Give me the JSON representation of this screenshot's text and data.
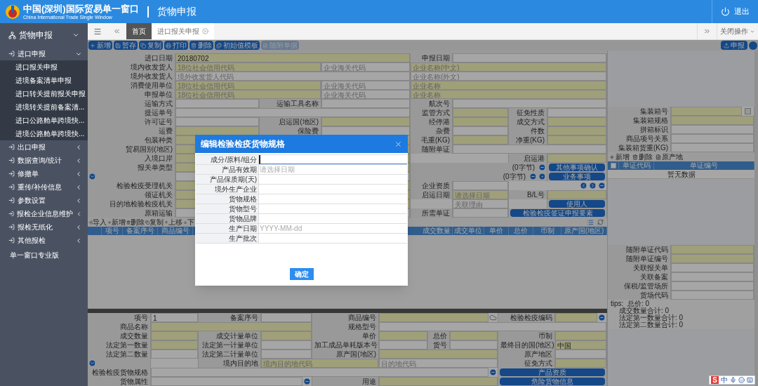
{
  "header": {
    "title": "中国(深圳)国际贸易单一窗口",
    "subtitle": "China International Trade Single Window",
    "section": "货物申报",
    "exit": "退出"
  },
  "sidebar": {
    "items": [
      {
        "label": "货物申报",
        "expanded": true,
        "children": [
          {
            "label": "进口申报",
            "expanded": true,
            "children": [
              {
                "label": "进口报关申报"
              },
              {
                "label": "进境备案清单申报"
              },
              {
                "label": "进口转关提前报关申报"
              },
              {
                "label": "进境转关提前备案清..."
              },
              {
                "label": "进口公路舱单跨境快..."
              },
              {
                "label": "进境公路舱单跨境快..."
              }
            ]
          },
          {
            "label": "出口申报",
            "expanded": false
          },
          {
            "label": "数据查询/统计",
            "expanded": false
          },
          {
            "label": "修撤单",
            "expanded": false
          },
          {
            "label": "重传/补传信息",
            "expanded": false
          },
          {
            "label": "参数设置",
            "expanded": false
          },
          {
            "label": "报检企业信息维护",
            "expanded": false
          },
          {
            "label": "报检无纸化",
            "expanded": false
          },
          {
            "label": "其他报检",
            "expanded": false
          }
        ]
      },
      {
        "label": "单一窗口专业版"
      }
    ]
  },
  "tabs": [
    {
      "label": "首页",
      "selected": false,
      "closable": false
    },
    {
      "label": "进口报关申报",
      "selected": true,
      "closable": true
    }
  ],
  "tab_menu": "关闭操作",
  "toolbar": {
    "buttons": [
      {
        "label": "新增",
        "disabled": false
      },
      {
        "label": "暂存",
        "disabled": false
      },
      {
        "label": "复制",
        "disabled": false
      },
      {
        "label": "打印",
        "disabled": false
      },
      {
        "label": "删除",
        "disabled": false
      },
      {
        "label": "初始值模板",
        "disabled": false
      },
      {
        "label": "随附单据",
        "disabled": true
      }
    ],
    "submit": "申报"
  },
  "main_form": {
    "lines": [
      {
        "items": [
          {
            "kind": "label",
            "text": "进口日期"
          },
          {
            "kind": "field",
            "value": "20180702",
            "required": true
          },
          {
            "kind": "label",
            "text": "申报日期"
          },
          {
            "kind": "field",
            "required": false
          }
        ]
      },
      {
        "items": [
          {
            "kind": "label",
            "text": "境内收发货人"
          },
          {
            "kind": "field",
            "placeholder": "18位社会信用代码",
            "required": true
          },
          {
            "kind": "field",
            "placeholder": "企业海关代码",
            "required": false
          },
          {
            "kind": "field",
            "placeholder": "企业名称(中文)",
            "required": true
          }
        ]
      },
      {
        "items": [
          {
            "kind": "label",
            "text": "境外收发货人"
          },
          {
            "kind": "field",
            "placeholder": "境外收发货人代码",
            "required": false
          },
          {
            "kind": "field",
            "placeholder": "企业名称(外文)",
            "required": false
          }
        ]
      },
      {
        "items": [
          {
            "kind": "label",
            "text": "消费使用单位"
          },
          {
            "kind": "field",
            "placeholder": "18位社会信用代码",
            "required": true
          },
          {
            "kind": "field",
            "placeholder": "企业海关代码",
            "required": false
          },
          {
            "kind": "field",
            "placeholder": "企业名称",
            "required": true
          }
        ]
      },
      {
        "items": [
          {
            "kind": "label",
            "text": "申报单位"
          },
          {
            "kind": "field",
            "placeholder": "18位社会信用代码",
            "required": true
          },
          {
            "kind": "field",
            "placeholder": "企业海关代码",
            "required": false
          },
          {
            "kind": "field",
            "placeholder": "企业名称",
            "required": true
          }
        ]
      },
      {
        "items": [
          {
            "kind": "label",
            "text": "运输方式"
          },
          {
            "kind": "field",
            "required": false
          },
          {
            "kind": "label",
            "text": "运输工具名称"
          },
          {
            "kind": "field",
            "required": false
          },
          {
            "kind": "label",
            "text": "航次号"
          },
          {
            "kind": "field",
            "required": false
          }
        ]
      },
      {
        "items": [
          {
            "kind": "label",
            "text": "提运单号"
          },
          {
            "kind": "field",
            "required": false
          },
          {
            "kind": "label",
            "text": "监管方式"
          },
          {
            "kind": "field",
            "required": true
          },
          {
            "kind": "label",
            "text": "征免性质"
          },
          {
            "kind": "field",
            "required": false
          }
        ]
      },
      {
        "items": [
          {
            "kind": "label",
            "text": "许可证号"
          },
          {
            "kind": "field",
            "required": false
          },
          {
            "kind": "label",
            "text": "启运国(地区)"
          },
          {
            "kind": "field",
            "required": true
          },
          {
            "kind": "label",
            "text": "经停港"
          },
          {
            "kind": "field",
            "required": true
          },
          {
            "kind": "label",
            "text": "成交方式"
          },
          {
            "kind": "field",
            "required": true
          }
        ]
      },
      {
        "items": [
          {
            "kind": "label",
            "text": "运费"
          },
          {
            "kind": "field",
            "required": true
          },
          {
            "kind": "label",
            "text": "保险费"
          },
          {
            "kind": "field",
            "required": false
          },
          {
            "kind": "label",
            "text": "杂费"
          },
          {
            "kind": "field",
            "required": false
          },
          {
            "kind": "label",
            "text": "件数"
          },
          {
            "kind": "field",
            "required": true
          }
        ]
      },
      {
        "items": [
          {
            "kind": "label",
            "text": "包装种类"
          },
          {
            "kind": "field",
            "required": true
          },
          {
            "kind": "label",
            "text": "毛重(KG)"
          },
          {
            "kind": "field",
            "required": true
          },
          {
            "kind": "label",
            "text": "净重(KG)"
          },
          {
            "kind": "field",
            "required": true
          }
        ]
      },
      {
        "items": [
          {
            "kind": "label",
            "text": "贸易国别(地区)"
          },
          {
            "kind": "field",
            "required": true
          },
          {
            "kind": "label",
            "text": "随附单证"
          },
          {
            "kind": "field",
            "required": false
          }
        ]
      },
      {
        "items": [
          {
            "kind": "label",
            "text": "入境口岸"
          },
          {
            "kind": "field",
            "required": true
          },
          {
            "kind": "blank"
          },
          {
            "kind": "label",
            "text": "启运港"
          },
          {
            "kind": "field",
            "required": true
          }
        ]
      },
      {
        "items": [
          {
            "kind": "label",
            "text": "报关单类型"
          },
          {
            "kind": "field",
            "required": true
          },
          {
            "kind": "note",
            "text": "(0字节)"
          },
          {
            "kind": "collapse"
          },
          {
            "kind": "button",
            "text": "其他事项确认"
          }
        ]
      },
      {
        "items": [
          {
            "kind": "expand"
          },
          {
            "kind": "field",
            "required": false
          },
          {
            "kind": "note",
            "text": "(0字节)"
          },
          {
            "kind": "collapse"
          },
          {
            "kind": "info"
          },
          {
            "kind": "button",
            "text": "业务事项"
          }
        ]
      },
      {
        "items": [
          {
            "kind": "label",
            "text": "检验检疫受理机关"
          },
          {
            "kind": "field",
            "required": true
          },
          {
            "kind": "label",
            "text": "企业资质"
          },
          {
            "kind": "field",
            "required": false
          },
          {
            "kind": "blank"
          },
          {
            "kind": "prev"
          },
          {
            "kind": "next"
          },
          {
            "kind": "collapse"
          }
        ]
      },
      {
        "items": [
          {
            "kind": "label",
            "text": "领证机关"
          },
          {
            "kind": "field",
            "required": true
          },
          {
            "kind": "label",
            "text": "启运日期"
          },
          {
            "kind": "field",
            "placeholder": "请选择日期",
            "required": true
          },
          {
            "kind": "label",
            "text": "B/L号"
          },
          {
            "kind": "field",
            "required": true
          }
        ]
      },
      {
        "items": [
          {
            "kind": "label",
            "text": "目的地检验检疫机关"
          },
          {
            "kind": "field",
            "required": true
          },
          {
            "kind": "blank"
          },
          {
            "kind": "field",
            "placeholder": "关联理由",
            "required": false
          },
          {
            "kind": "blank"
          },
          {
            "kind": "button",
            "text": "使用人"
          }
        ]
      },
      {
        "items": [
          {
            "kind": "label",
            "text": "原箱运输"
          },
          {
            "kind": "field",
            "required": false
          },
          {
            "kind": "label",
            "text": "所需单证"
          },
          {
            "kind": "field",
            "required": false
          },
          {
            "kind": "button",
            "text": "检验检疫签证申报要素"
          }
        ]
      }
    ]
  },
  "goods": {
    "toolbar": [
      "导入",
      "新增",
      "删除",
      "复制",
      "上移",
      "下"
    ],
    "columns": [
      "项号",
      "备案序号",
      "商品编号",
      "成交数量",
      "成交单位",
      "单价",
      "总价",
      "币制",
      "原产国(地区)"
    ]
  },
  "goods_form": {
    "lines": [
      {
        "items": [
          {
            "kind": "label",
            "text": "项号"
          },
          {
            "kind": "field",
            "value": "1",
            "required": false
          },
          {
            "kind": "label",
            "text": "备案序号"
          },
          {
            "kind": "field",
            "required": false
          },
          {
            "kind": "label",
            "text": "商品编号"
          },
          {
            "kind": "field",
            "required": true
          },
          {
            "kind": "lookup"
          },
          {
            "kind": "label",
            "text": "检验检疫编码"
          },
          {
            "kind": "field",
            "required": true
          },
          {
            "kind": "collapse"
          }
        ]
      },
      {
        "items": [
          {
            "kind": "label",
            "text": "商品名称"
          },
          {
            "kind": "field",
            "required": true
          },
          {
            "kind": "label",
            "text": "规格型号"
          },
          {
            "kind": "field",
            "required": false
          }
        ]
      },
      {
        "items": [
          {
            "kind": "label",
            "text": "成交数量"
          },
          {
            "kind": "field",
            "required": true
          },
          {
            "kind": "label",
            "text": "成交计量单位"
          },
          {
            "kind": "field",
            "required": true
          },
          {
            "kind": "label",
            "text": "单价"
          },
          {
            "kind": "field",
            "required": true
          },
          {
            "kind": "label",
            "text": "总价"
          },
          {
            "kind": "field",
            "required": true
          },
          {
            "kind": "label",
            "text": "币制"
          },
          {
            "kind": "field",
            "required": true
          }
        ]
      },
      {
        "items": [
          {
            "kind": "label",
            "text": "法定第一数量"
          },
          {
            "kind": "field",
            "required": true
          },
          {
            "kind": "label",
            "text": "法定第一计量单位"
          },
          {
            "kind": "field",
            "required": false
          },
          {
            "kind": "label",
            "text": "加工成品单耗版本号"
          },
          {
            "kind": "field",
            "required": false
          },
          {
            "kind": "label",
            "text": "货号"
          },
          {
            "kind": "field",
            "required": false
          },
          {
            "kind": "label",
            "text": "最终目的国(地区)"
          },
          {
            "kind": "field",
            "value": "中国",
            "required": true
          }
        ]
      },
      {
        "items": [
          {
            "kind": "label",
            "text": "法定第二数量"
          },
          {
            "kind": "field",
            "required": false
          },
          {
            "kind": "label",
            "text": "法定第二计量单位"
          },
          {
            "kind": "field",
            "required": false
          },
          {
            "kind": "label",
            "text": "原产国(地区)"
          },
          {
            "kind": "field",
            "required": true
          },
          {
            "kind": "label",
            "text": "原产地区"
          },
          {
            "kind": "field",
            "required": false
          }
        ]
      },
      {
        "items": [
          {
            "kind": "expand"
          },
          {
            "kind": "blank"
          },
          {
            "kind": "label",
            "text": "境内目的地"
          },
          {
            "kind": "field",
            "placeholder": "境内目的地代码",
            "required": true
          },
          {
            "kind": "field",
            "placeholder": "目的地代码",
            "required": false
          },
          {
            "kind": "label",
            "text": "征免方式"
          },
          {
            "kind": "field",
            "required": true
          }
        ]
      },
      {
        "items": [
          {
            "kind": "label",
            "text": "检验检疫货物规格"
          },
          {
            "kind": "field",
            "required": false
          },
          {
            "kind": "collapse"
          },
          {
            "kind": "button",
            "text": "产品资质"
          }
        ]
      },
      {
        "items": [
          {
            "kind": "label",
            "text": "货物属性"
          },
          {
            "kind": "field",
            "required": false
          },
          {
            "kind": "collapse"
          },
          {
            "kind": "label",
            "text": "用途"
          },
          {
            "kind": "field",
            "required": true
          },
          {
            "kind": "button",
            "text": "危险货物信息"
          }
        ]
      }
    ]
  },
  "right_panel": {
    "lines": [
      {
        "items": [
          {
            "kind": "label",
            "text": "集装箱号"
          },
          {
            "kind": "field",
            "required": true
          },
          {
            "kind": "checkbox",
            "checked": false
          }
        ]
      },
      {
        "items": [
          {
            "kind": "label",
            "text": "集装箱规格"
          },
          {
            "kind": "field",
            "required": true
          }
        ]
      },
      {
        "items": [
          {
            "kind": "label",
            "text": "拼箱标识"
          },
          {
            "kind": "field",
            "required": false
          }
        ]
      },
      {
        "items": [
          {
            "kind": "label",
            "text": "商品项号关系"
          },
          {
            "kind": "field",
            "required": false
          }
        ]
      },
      {
        "items": [
          {
            "kind": "label",
            "text": "集装箱货重(KG)"
          },
          {
            "kind": "field",
            "required": false
          }
        ]
      }
    ],
    "toolbar": [
      "新增",
      "删除",
      "原产地"
    ],
    "select_all": {
      "checked": false
    },
    "columns": [
      "单证代码",
      "单证编号"
    ],
    "empty": "暂无数据",
    "lines_2": [
      {
        "items": [
          {
            "kind": "label",
            "text": "随附单证代码"
          },
          {
            "kind": "field",
            "required": true
          }
        ]
      },
      {
        "items": [
          {
            "kind": "label",
            "text": "随附单证编号"
          },
          {
            "kind": "field",
            "required": true
          }
        ]
      },
      {
        "items": [
          {
            "kind": "label",
            "text": "关联报关单"
          },
          {
            "kind": "field",
            "required": false
          }
        ]
      },
      {
        "items": [
          {
            "kind": "label",
            "text": "关联备案"
          },
          {
            "kind": "field",
            "required": false
          }
        ]
      },
      {
        "items": [
          {
            "kind": "label",
            "text": "保税/监管场所"
          },
          {
            "kind": "field",
            "required": false
          }
        ]
      },
      {
        "items": [
          {
            "kind": "label",
            "text": "货场代码"
          },
          {
            "kind": "field",
            "required": false
          }
        ]
      }
    ],
    "tips": [
      "tips:  总价: 0",
      "成交数量合计: 0",
      "法定第一数量合计: 0",
      "法定第二数量合计: 0"
    ]
  },
  "dialog": {
    "title": "编辑检验检疫货物规格",
    "fields": [
      {
        "label": "成分/原料/组分",
        "focused": true
      },
      {
        "label": "产品有效期",
        "placeholder": "请选择日期",
        "focused": false
      },
      {
        "label": "产品保质期(天)",
        "focused": false
      },
      {
        "label": "境外生产企业",
        "focused": false
      },
      {
        "label": "货物规格",
        "focused": false
      },
      {
        "label": "货物型号",
        "focused": false
      },
      {
        "label": "货物品牌",
        "focused": false
      },
      {
        "label": "生产日期",
        "placeholder": "YYYY-MM-dd",
        "focused": false
      },
      {
        "label": "生产批次",
        "focused": false
      }
    ],
    "confirm": "确定"
  },
  "ime_bar": {
    "logo": "S",
    "mode": "中"
  }
}
